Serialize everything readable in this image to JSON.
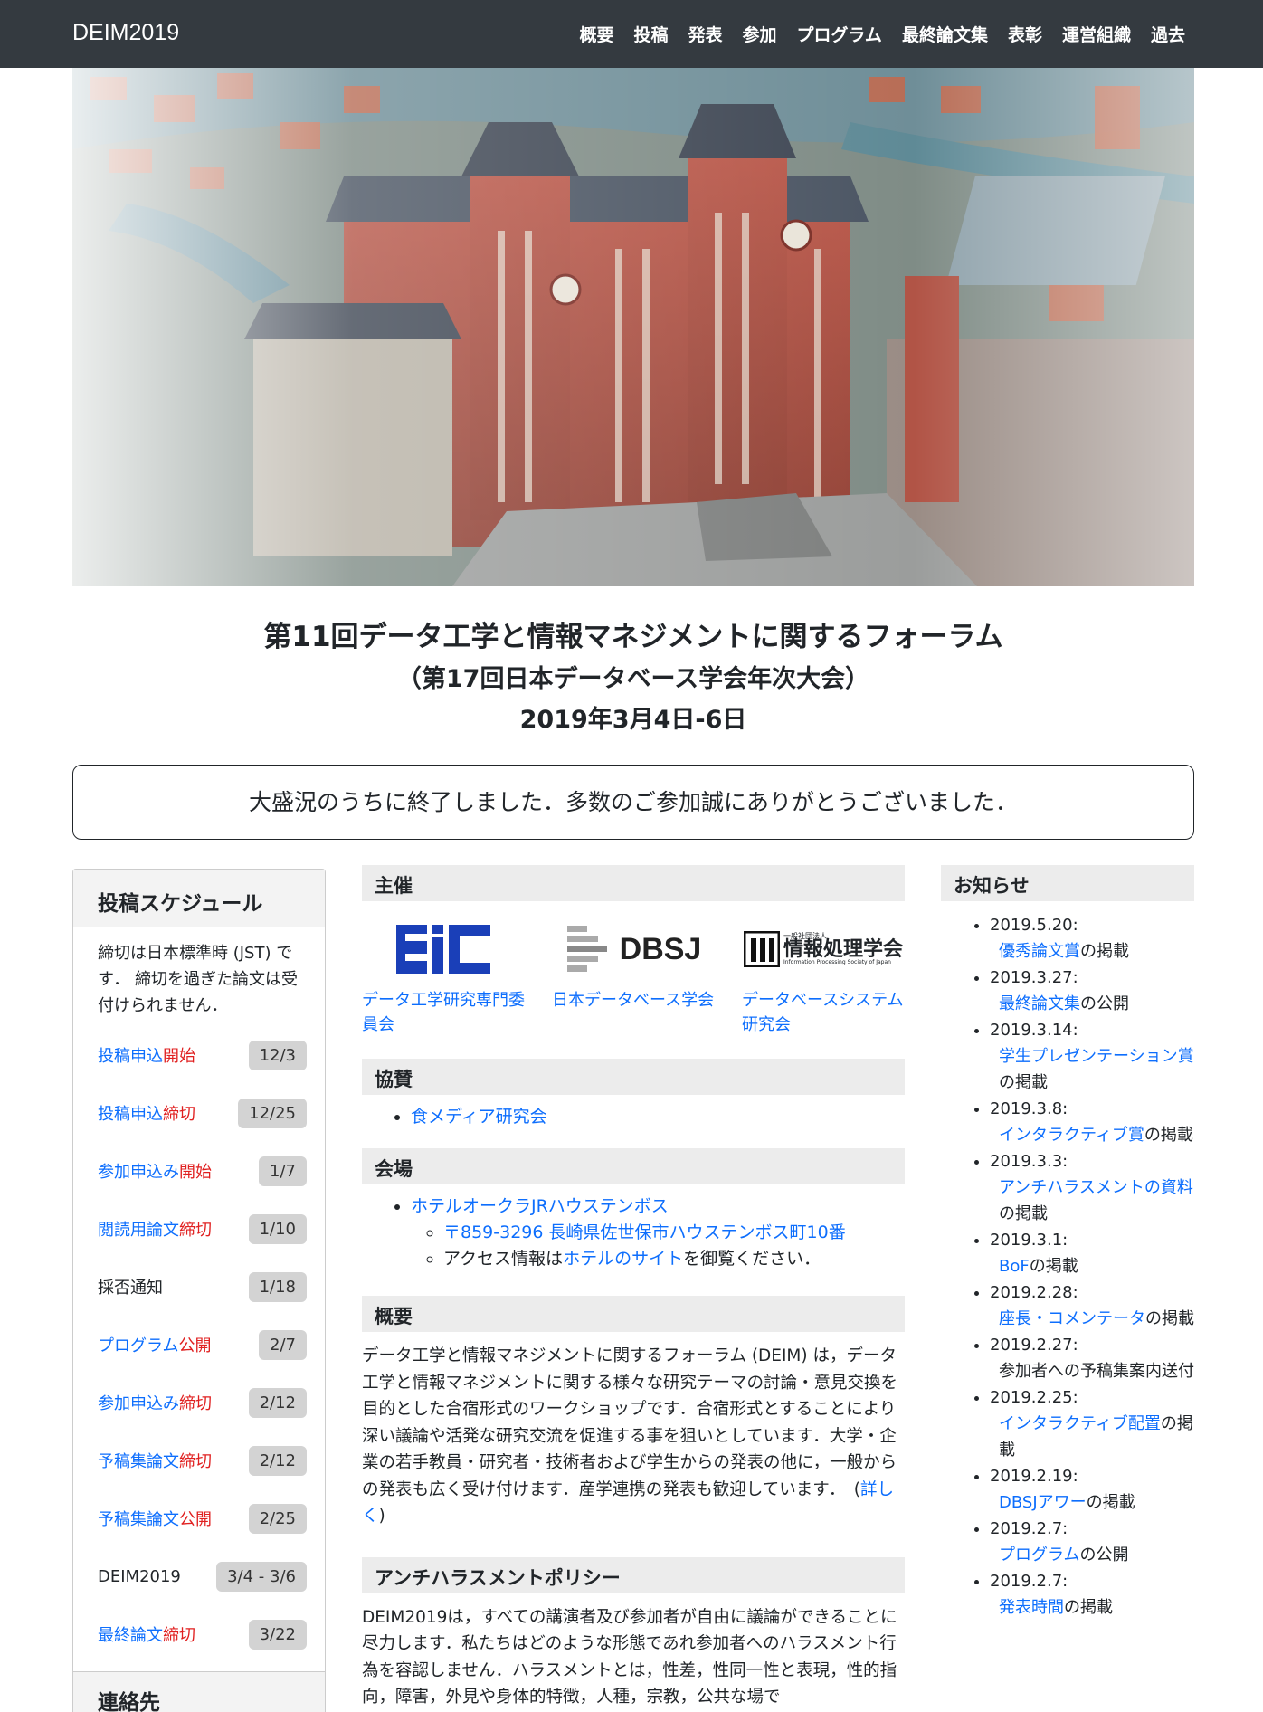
{
  "nav": {
    "brand": "DEIM2019",
    "items": [
      "概要",
      "投稿",
      "発表",
      "参加",
      "プログラム",
      "最終論文集",
      "表彰",
      "運営組織",
      "過去"
    ]
  },
  "title": {
    "line1": "第11回データ工学と情報マネジメントに関するフォーラム",
    "line2": "（第17回日本データベース学会年次大会）",
    "line3": "2019年3月4日-6日"
  },
  "notice": "大盛況のうちに終了しました．多数のご参加誠にありがとうございました．",
  "schedule": {
    "heading": "投稿スケジュール",
    "note": "締切は日本標準時 (JST) です． 締切を過ぎた論文は受付けられません．",
    "items": [
      {
        "label": "投稿申込開始",
        "date": "12/3"
      },
      {
        "label": "投稿申込締切",
        "date": "12/25"
      },
      {
        "label": "参加申込み開始",
        "date": "1/7"
      },
      {
        "label": "閲読用論文締切",
        "date": "1/10"
      },
      {
        "label": "採否通知",
        "date": "1/18"
      },
      {
        "label": "プログラム公開",
        "date": "2/7"
      },
      {
        "label": "参加申込み締切",
        "date": "2/12"
      },
      {
        "label": "予稿集論文締切",
        "date": "2/12"
      },
      {
        "label": "予稿集論文公開",
        "date": "2/25"
      },
      {
        "label": "DEIM2019",
        "date": "3/4 - 3/6"
      },
      {
        "label": "最終論文締切",
        "date": "3/22"
      }
    ],
    "contact_heading": "連絡先"
  },
  "organizers": {
    "heading": "主催",
    "logos": [
      {
        "logo_text": "EiC",
        "caption": "データ工学研究専門委員会"
      },
      {
        "logo_text": "DBSJ",
        "caption": "日本データベース学会"
      },
      {
        "logo_text_small": "一般社団法人",
        "logo_text": "情報処理学会",
        "logo_text_en": "Information Processing Society of Japan",
        "caption": "データベースシステム研究会"
      }
    ]
  },
  "sponsors": {
    "heading": "協賛",
    "items": [
      "食メディア研究会"
    ]
  },
  "venue": {
    "heading": "会場",
    "name": "ホテルオークラJRハウステンボス",
    "address": "〒859-3296 長崎県佐世保市ハウステンボス町10番",
    "access_pre": "アクセス情報は",
    "access_link": "ホテルのサイト",
    "access_post": "を御覧ください．"
  },
  "overview": {
    "heading": "概要",
    "text": "データ工学と情報マネジメントに関するフォーラム (DEIM) は，データ工学と情報マネジメントに関する様々な研究テーマの討論・意見交換を目的とした合宿形式のワークショップです．合宿形式とすることにより深い議論や活発な研究交流を促進する事を狙いとしています．大学・企業の若手教員・研究者・技術者および学生からの発表の他に，一般からの発表も広く受け付けます．産学連携の発表も歓迎しています．　(",
    "more": "詳しく",
    "close": ")"
  },
  "policy": {
    "heading": "アンチハラスメントポリシー",
    "text": "DEIM2019は，すべての講演者及び参加者が自由に議論ができることに尽力します．私たちはどのような形態であれ参加者へのハラスメント行為を容認しません．ハラスメントとは，性差，性同一性と表現，性的指向，障害，外見や身体的特徴，人種，宗教，公共な場で"
  },
  "news": {
    "heading": "お知らせ",
    "items": [
      {
        "date": "2019.5.20:",
        "link": "優秀論文賞",
        "rest": "の掲載"
      },
      {
        "date": "2019.3.27:",
        "link": "最終論文集",
        "rest": "の公開"
      },
      {
        "date": "2019.3.14:",
        "link": "学生プレゼンテーション賞",
        "rest": "の掲載"
      },
      {
        "date": "2019.3.8:",
        "link": "インタラクティブ賞",
        "rest": "の掲載"
      },
      {
        "date": "2019.3.3:",
        "link": "アンチハラスメントの資料",
        "rest": "の掲載"
      },
      {
        "date": "2019.3.1:",
        "link": "BoF",
        "rest": "の掲載"
      },
      {
        "date": "2019.2.28:",
        "link": "座長・コメンテータ",
        "rest": "の掲載"
      },
      {
        "date": "2019.2.27:",
        "link": "",
        "rest": "参加者への予稿集案内送付"
      },
      {
        "date": "2019.2.25:",
        "link": "インタラクティブ配置",
        "rest": "の掲載"
      },
      {
        "date": "2019.2.19:",
        "link": "DBSJアワー",
        "rest": "の掲載"
      },
      {
        "date": "2019.2.7:",
        "link": "プログラム",
        "rest": "の公開"
      },
      {
        "date": "2019.2.7:",
        "link": "発表時間",
        "rest": "の掲載"
      }
    ]
  },
  "colors": {
    "navbar": "#343a40",
    "link": "#0d6efd",
    "deadline": "#e02020"
  }
}
